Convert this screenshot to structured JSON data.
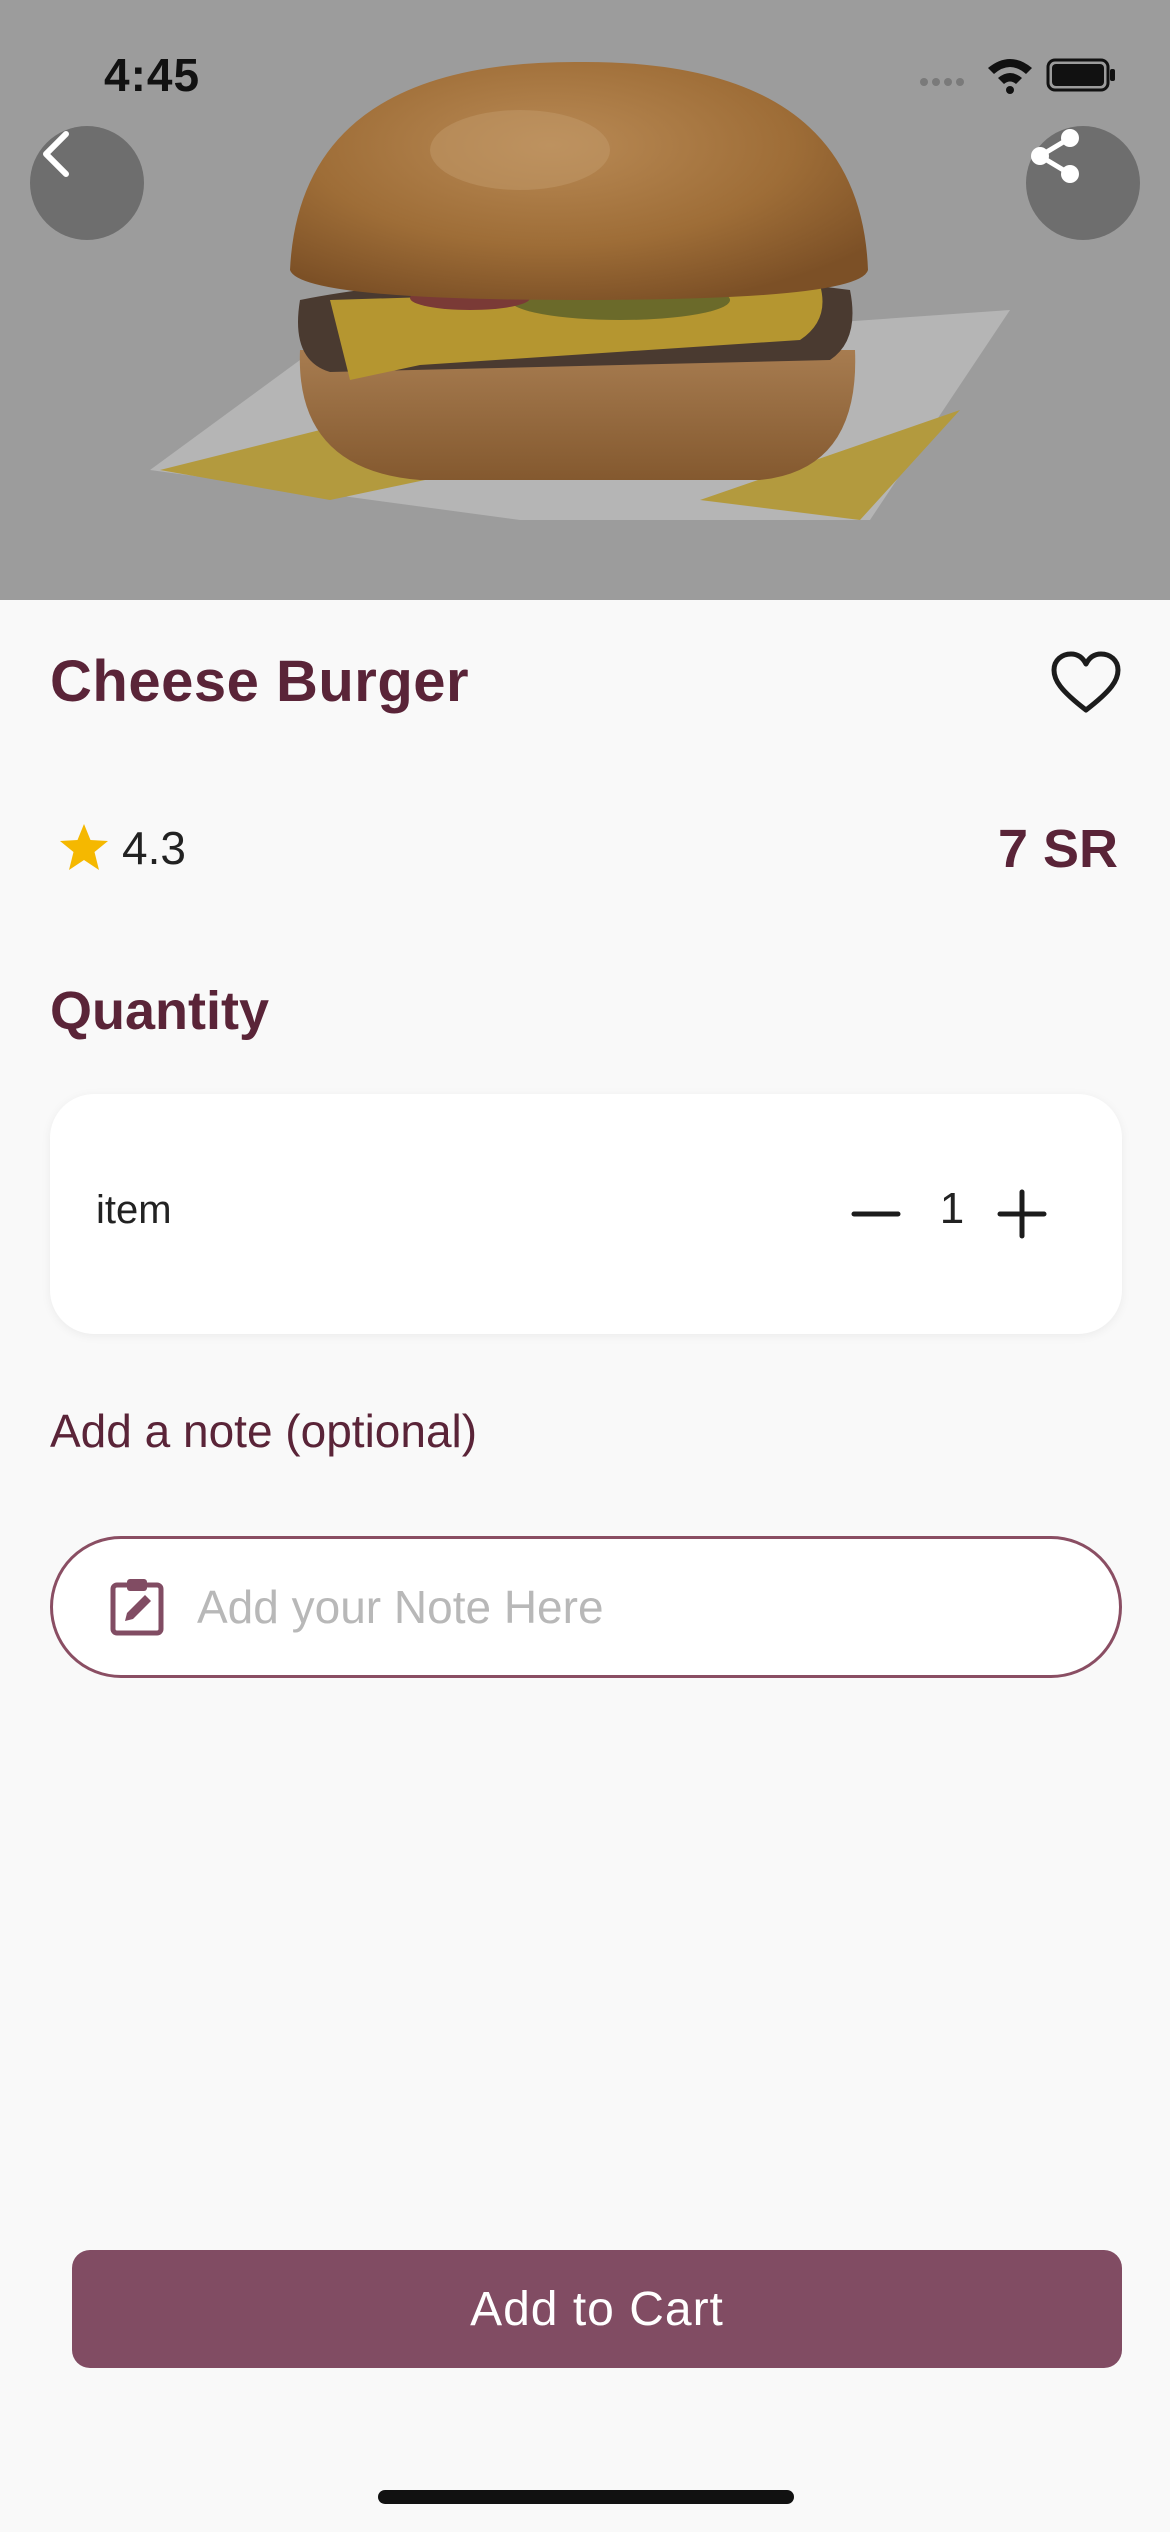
{
  "status_bar": {
    "time": "4:45"
  },
  "product": {
    "name": "Cheese Burger",
    "rating": "4.3",
    "price": "7 SR"
  },
  "quantity": {
    "label": "Quantity",
    "item_label": "item",
    "value": "1"
  },
  "note": {
    "label": "Add a note (optional)",
    "placeholder": "Add your Note Here"
  },
  "actions": {
    "add_to_cart": "Add to Cart"
  },
  "colors": {
    "brand": "#5a2438",
    "button": "#814c63",
    "star": "#f5b800",
    "hero_overlay": "#9c9c9c"
  },
  "icons": {
    "back": "chevron-left-icon",
    "share": "share-icon",
    "favorite": "heart-outline-icon",
    "rating": "star-icon",
    "minus": "minus-icon",
    "plus": "plus-icon",
    "note": "clipboard-edit-icon"
  }
}
